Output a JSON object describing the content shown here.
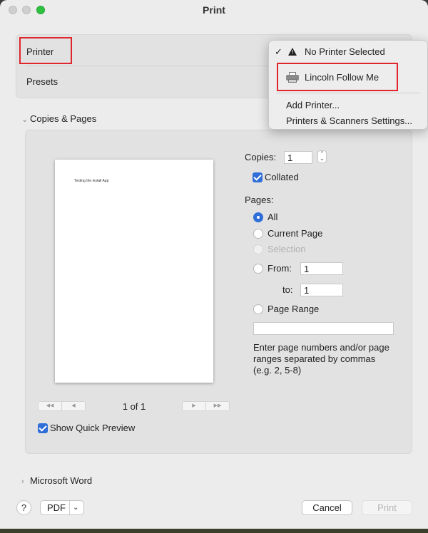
{
  "window": {
    "title": "Print"
  },
  "printer_section": {
    "printer_label": "Printer",
    "presets_label": "Presets"
  },
  "printer_menu": {
    "selected_check": "✓",
    "items": [
      {
        "label": "No Printer Selected",
        "icon": "warning-icon",
        "checked": true
      },
      {
        "label": "Lincoln Follow Me",
        "icon": "printer-icon",
        "checked": false
      },
      {
        "label": "Add Printer..."
      },
      {
        "label": "Printers & Scanners Settings..."
      }
    ]
  },
  "copies_pages": {
    "section_title": "Copies & Pages",
    "preview_text": "Testing the install App",
    "page_count": "1 of 1",
    "show_preview_label": "Show Quick Preview",
    "show_preview_checked": true,
    "copies_label": "Copies:",
    "copies_value": "1",
    "collated_label": "Collated",
    "collated_checked": true,
    "pages_label": "Pages:",
    "options": {
      "all": "All",
      "current": "Current Page",
      "selection": "Selection",
      "from": "From:",
      "to": "to:",
      "range": "Page Range"
    },
    "selected_option": "All",
    "from_value": "1",
    "to_value": "1",
    "range_value": "",
    "range_help": "Enter page numbers and/or page ranges separated by commas (e.g. 2, 5-8)"
  },
  "microsoft_word": {
    "section_title": "Microsoft Word"
  },
  "bottom": {
    "help_label": "?",
    "pdf_label": "PDF",
    "cancel_label": "Cancel",
    "print_label": "Print"
  },
  "colors": {
    "accent": "#2f6ed8",
    "highlight_box": "#e0262d"
  }
}
